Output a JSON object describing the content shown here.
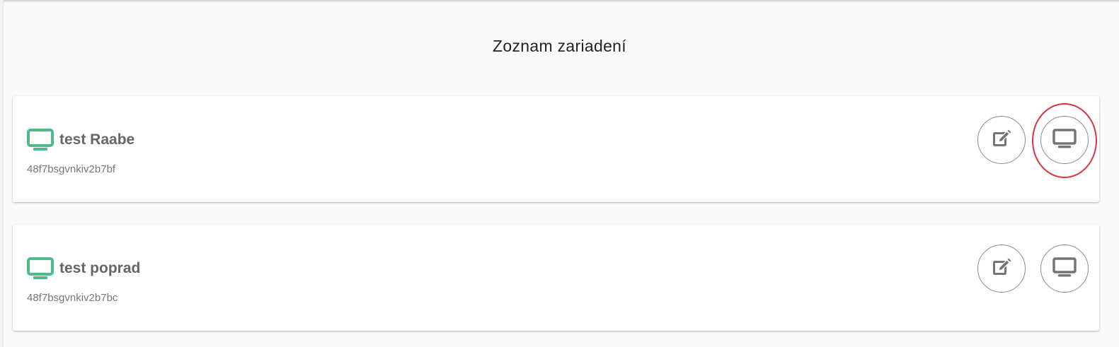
{
  "page": {
    "title": "Zoznam zariadení"
  },
  "colors": {
    "device_icon": "#4dbb8a",
    "action_icon": "#757575",
    "highlight": "#d33a3f"
  },
  "devices": [
    {
      "name": "test Raabe",
      "id": "48f7bsgvnkiv2b7bf",
      "icon": "monitor-icon",
      "actions": [
        "edit-icon",
        "monitor-icon"
      ],
      "highlighted_action": "monitor-icon"
    },
    {
      "name": "test poprad",
      "id": "48f7bsgvnkiv2b7bc",
      "icon": "monitor-icon",
      "actions": [
        "edit-icon",
        "monitor-icon"
      ]
    }
  ]
}
